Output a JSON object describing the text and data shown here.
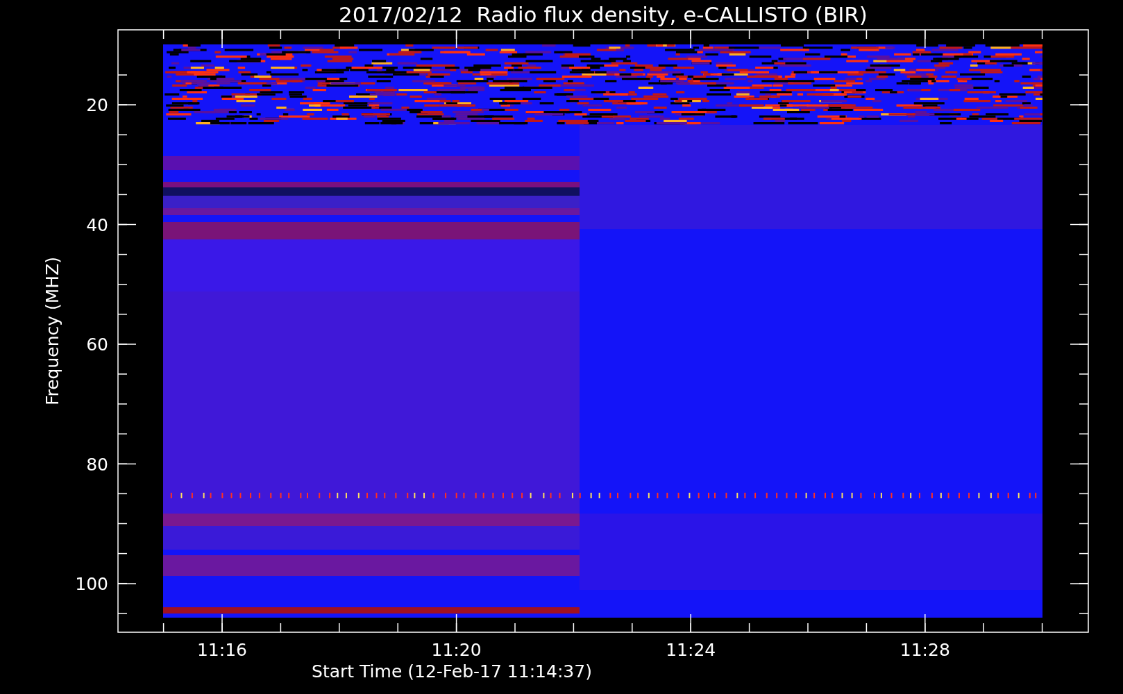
{
  "title": "2017/02/12  Radio flux density, e-CALLISTO (BIR)",
  "y_axis": {
    "label": "Frequency (MHZ)",
    "ticks": [
      "20",
      "40",
      "60",
      "80",
      "100"
    ]
  },
  "x_axis": {
    "label": "Start Time (12-Feb-17 11:14:37)",
    "ticks": [
      "11:16",
      "11:20",
      "11:24",
      "11:28"
    ]
  }
}
